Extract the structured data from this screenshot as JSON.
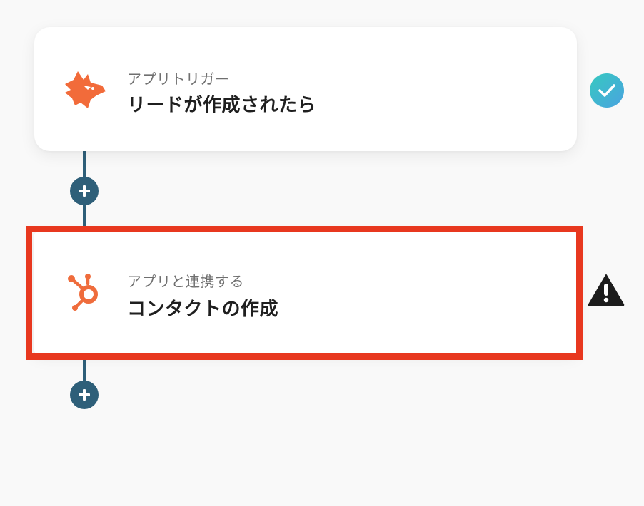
{
  "flow": {
    "steps": [
      {
        "subtitle": "アプリトリガー",
        "title": "リードが作成されたら",
        "app_icon": "hunter-fox-icon",
        "status_icon": "check-circle-icon",
        "status": "complete"
      },
      {
        "subtitle": "アプリと連携する",
        "title": "コンタクトの作成",
        "app_icon": "hubspot-icon",
        "status_icon": "warning-triangle-icon",
        "status": "warning",
        "highlighted": true
      }
    ],
    "add_step_icon": "plus-icon"
  },
  "colors": {
    "background": "#f9f9f9",
    "connector": "#2e5f79",
    "highlight": "#e8381f",
    "fox_orange": "#f26b3a",
    "hubspot_orange": "#ef6c3c",
    "check_gradient_start": "#36c9c0",
    "check_gradient_end": "#4aa3e0",
    "warning": "#1c1c1c"
  }
}
